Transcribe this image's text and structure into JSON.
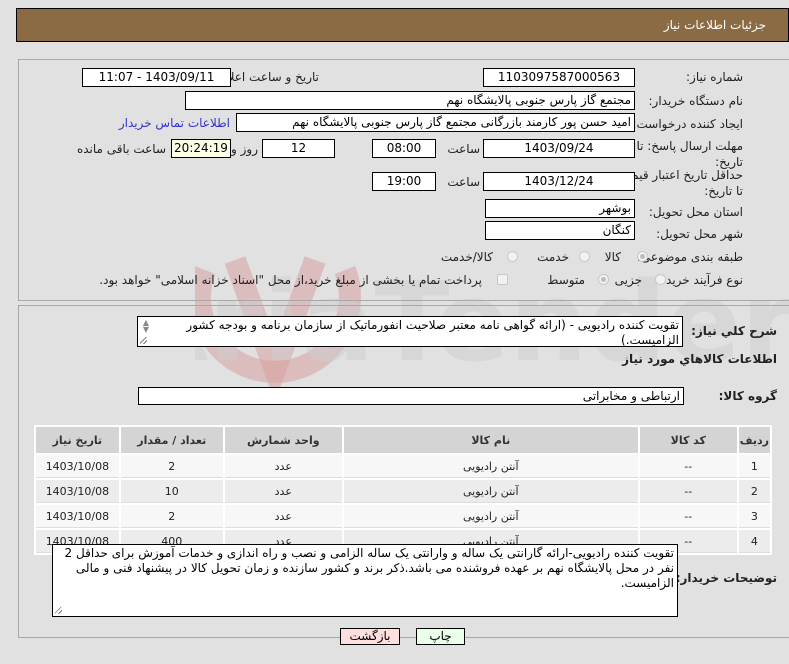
{
  "header": {
    "title": "جزئیات اطلاعات نیاز"
  },
  "form": {
    "need_number_label": "شماره نیاز:",
    "need_number": "1103097587000563",
    "announce_label": "تاریخ و ساعت اعلان عمومی:",
    "announce_value": "1403/09/11 - 11:07",
    "buyer_org_label": "نام دستگاه خریدار:",
    "buyer_org": "مجتمع گاز پارس جنوبی  پالایشگاه نهم",
    "creator_label": "ایجاد کننده درخواست:",
    "creator": "امید حسن پور کارمند بازرگانی مجتمع گاز پارس جنوبی  پالایشگاه نهم",
    "contact_link": "اطلاعات تماس خریدار",
    "reply_deadline_label": "مهلت ارسال پاسخ: تا تاریخ:",
    "reply_date": "1403/09/24",
    "time_label": "ساعت",
    "reply_time": "08:00",
    "days": "12",
    "days_label": "روز و",
    "remaining_time": "20:24:19",
    "remaining_label": "ساعت باقی مانده",
    "price_validity_label": "حداقل تاریخ اعتبار قیمت: تا تاریخ:",
    "price_validity_date": "1403/12/24",
    "price_validity_time": "19:00",
    "province_label": "استان محل تحویل:",
    "province": "بوشهر",
    "city_label": "شهر محل تحویل:",
    "city": "کنگان",
    "category_label": "طبقه بندی موضوعی:",
    "category_options": [
      {
        "label": "کالا",
        "selected": true
      },
      {
        "label": "خدمت",
        "selected": false
      },
      {
        "label": "کالا/خدمت",
        "selected": false
      }
    ],
    "process_label": "نوع فرآیند خرید :",
    "process_options": [
      {
        "label": "جزیی",
        "selected": false
      },
      {
        "label": "متوسط",
        "selected": true
      }
    ],
    "treasury_checkbox_label": "پرداخت تمام یا بخشی از مبلغ خرید،از محل \"اسناد خزانه اسلامی\" خواهد بود.",
    "treasury_checked": false
  },
  "description": {
    "label": "شرح کلي نياز:",
    "value": "تقویت کننده رادیویی - (ارائه گواهی نامه معتبر صلاحیت انفورماتیک از سازمان برنامه و بودجه کشور الزامیست.)"
  },
  "goods": {
    "section_title": "اطلاعات کالاهاي مورد نياز",
    "group_label": "گروه کالا:",
    "group_value": "ارتباطی و مخابراتی",
    "columns": [
      "ردیف",
      "کد کالا",
      "نام کالا",
      "واحد شمارش",
      "تعداد / مقدار",
      "تاریخ نیاز"
    ],
    "rows": [
      {
        "row": "1",
        "code": "--",
        "name": "آنتن رادیویی",
        "unit": "عدد",
        "qty": "2",
        "date": "1403/10/08"
      },
      {
        "row": "2",
        "code": "--",
        "name": "آنتن رادیویی",
        "unit": "عدد",
        "qty": "10",
        "date": "1403/10/08"
      },
      {
        "row": "3",
        "code": "--",
        "name": "آنتن رادیویی",
        "unit": "عدد",
        "qty": "2",
        "date": "1403/10/08"
      },
      {
        "row": "4",
        "code": "--",
        "name": "آنتن رادیویی",
        "unit": "عدد",
        "qty": "400",
        "date": "1403/10/08"
      }
    ]
  },
  "buyer_notes": {
    "label": "توضیحات خریدار:",
    "value": "تقویت کننده رادیویی-ارائه گارانتی یک ساله و وارانتی یک ساله الزامی و نصب و راه اندازی و خدمات آموزش برای حداقل 2 نفر در محل پالایشگاه نهم بر عهده فروشنده می باشد.ذکر برند و کشور سازنده و زمان تحویل کالا در پیشنهاد فنی و مالی الزامیست."
  },
  "buttons": {
    "print": "چاپ",
    "back": "بازگشت"
  },
  "colors": {
    "header_bg": "#8b6b43",
    "print_bg": "#eaffea",
    "back_bg": "#ffdede",
    "link": "#3333cc"
  }
}
